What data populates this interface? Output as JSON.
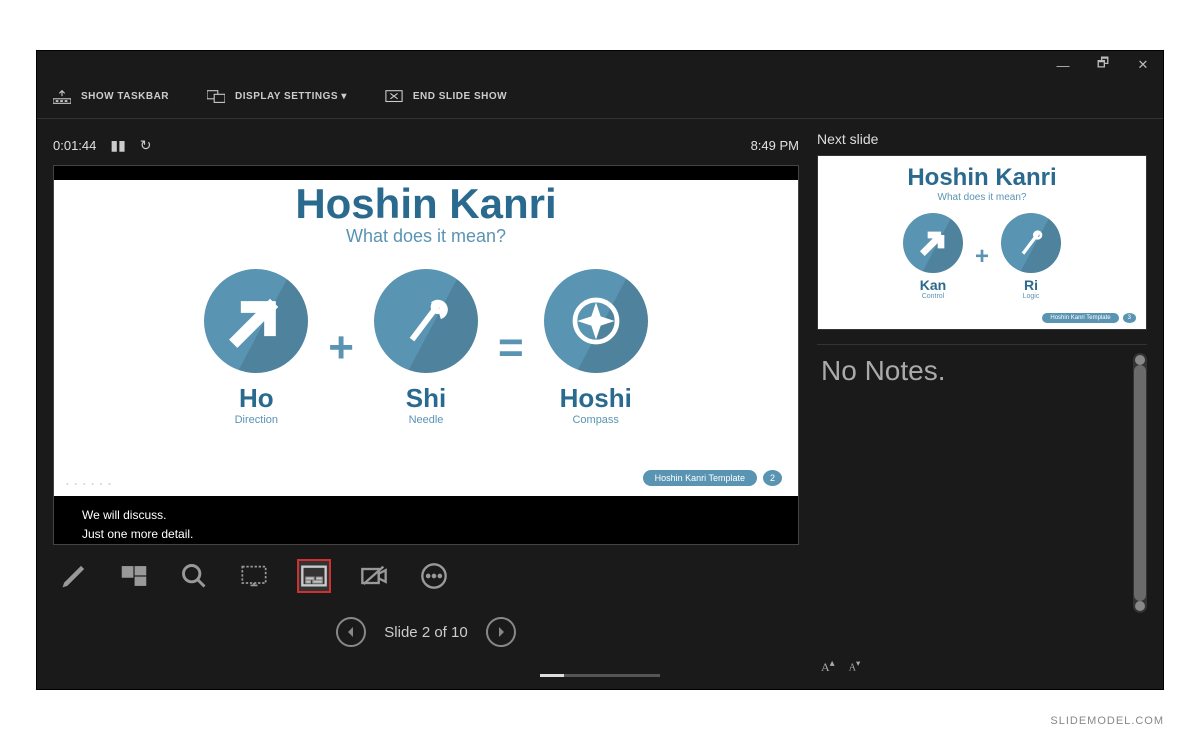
{
  "toolbar": {
    "show_taskbar": "SHOW TASKBAR",
    "display_settings": "DISPLAY SETTINGS ▾",
    "end_show": "END SLIDE SHOW"
  },
  "timer": {
    "elapsed": "0:01:44",
    "clock": "8:49 PM"
  },
  "current_slide": {
    "title": "Hoshin Kanri",
    "subtitle": "What does it mean?",
    "terms": [
      {
        "name": "Ho",
        "meaning": "Direction"
      },
      {
        "name": "Shi",
        "meaning": "Needle"
      },
      {
        "name": "Hoshi",
        "meaning": "Compass"
      }
    ],
    "footer_label": "Hoshin Kanri Template",
    "footer_num": "2"
  },
  "captions": {
    "line1": "We will discuss.",
    "line2": "Just one more detail."
  },
  "navigation": {
    "label": "Slide 2 of 10"
  },
  "next": {
    "heading": "Next slide",
    "title": "Hoshin Kanri",
    "subtitle": "What does it mean?",
    "terms": [
      {
        "name": "Kan",
        "meaning": "Control"
      },
      {
        "name": "Ri",
        "meaning": "Logic"
      }
    ],
    "footer_label": "Hoshin Kanri Template",
    "footer_num": "3"
  },
  "notes": {
    "text": "No Notes."
  },
  "watermark": "SLIDEMODEL.COM"
}
